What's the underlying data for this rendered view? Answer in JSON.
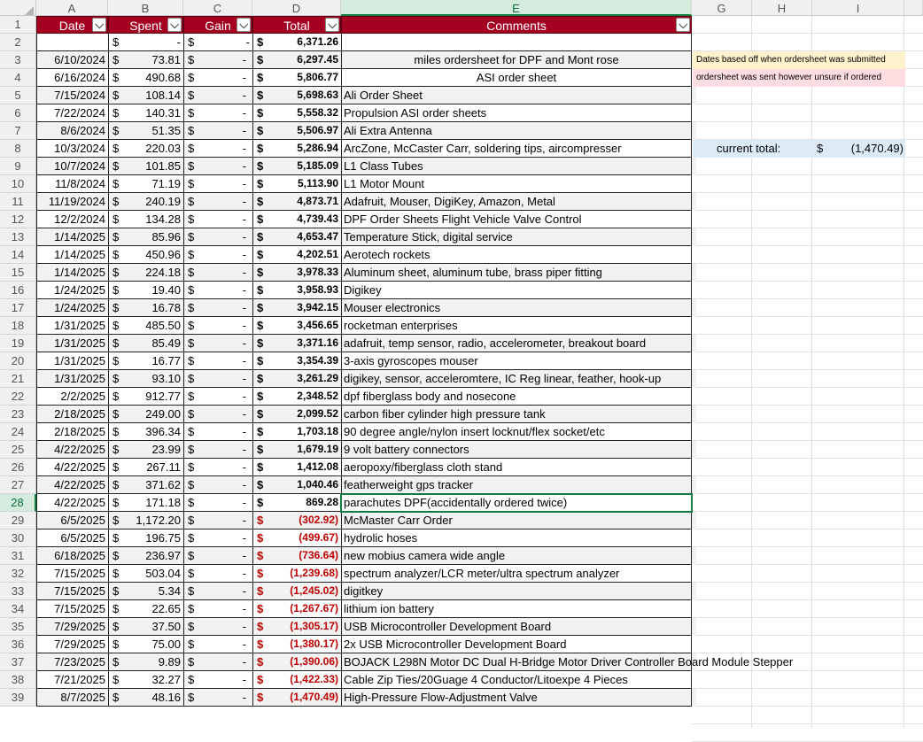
{
  "columns": [
    "A",
    "B",
    "C",
    "D",
    "E",
    "G",
    "H",
    "I"
  ],
  "headers": {
    "date": "Date",
    "spent": "Spent",
    "gain": "Gain",
    "total": "Total",
    "comments": "Comments"
  },
  "currency": "$",
  "first_row": {
    "row": "2",
    "spent": "-",
    "gain": "-",
    "total": "6,371.26",
    "comment": ""
  },
  "rows": [
    {
      "row": "3",
      "date": "6/10/2024",
      "spent": "73.81",
      "gain": "-",
      "total": "6,297.45",
      "comment": "miles ordersheet for DPF and Mont rose",
      "neg": false,
      "center": true
    },
    {
      "row": "4",
      "date": "6/16/2024",
      "spent": "490.68",
      "gain": "-",
      "total": "5,806.77",
      "comment": "ASI order sheet",
      "neg": false,
      "center": true
    },
    {
      "row": "5",
      "date": "7/15/2024",
      "spent": "108.14",
      "gain": "-",
      "total": "5,698.63",
      "comment": "Ali Order Sheet",
      "neg": false
    },
    {
      "row": "6",
      "date": "7/22/2024",
      "spent": "140.31",
      "gain": "-",
      "total": "5,558.32",
      "comment": "Propulsion ASI order sheets",
      "neg": false
    },
    {
      "row": "7",
      "date": "8/6/2024",
      "spent": "51.35",
      "gain": "-",
      "total": "5,506.97",
      "comment": "Ali Extra Antenna",
      "neg": false
    },
    {
      "row": "8",
      "date": "10/3/2024",
      "spent": "220.03",
      "gain": "-",
      "total": "5,286.94",
      "comment": "ArcZone, McCaster Carr, soldering tips, aircompresser",
      "neg": false
    },
    {
      "row": "9",
      "date": "10/7/2024",
      "spent": "101.85",
      "gain": "-",
      "total": "5,185.09",
      "comment": "L1 Class Tubes",
      "neg": false
    },
    {
      "row": "10",
      "date": "11/8/2024",
      "spent": "71.19",
      "gain": "-",
      "total": "5,113.90",
      "comment": "L1 Motor Mount",
      "neg": false
    },
    {
      "row": "11",
      "date": "11/19/2024",
      "spent": "240.19",
      "gain": "-",
      "total": "4,873.71",
      "comment": "Adafruit, Mouser, DigiKey, Amazon, Metal",
      "neg": false
    },
    {
      "row": "12",
      "date": "12/2/2024",
      "spent": "134.28",
      "gain": "-",
      "total": "4,739.43",
      "comment": "DPF Order Sheets Flight Vehicle Valve Control",
      "neg": false
    },
    {
      "row": "13",
      "date": "1/14/2025",
      "spent": "85.96",
      "gain": "-",
      "total": "4,653.47",
      "comment": "Temperature Stick, digital service",
      "neg": false
    },
    {
      "row": "14",
      "date": "1/14/2025",
      "spent": "450.96",
      "gain": "-",
      "total": "4,202.51",
      "comment": "Aerotech rockets",
      "neg": false
    },
    {
      "row": "15",
      "date": "1/14/2025",
      "spent": "224.18",
      "gain": "-",
      "total": "3,978.33",
      "comment": "Aluminum sheet, aluminum tube, brass piper fitting",
      "neg": false
    },
    {
      "row": "16",
      "date": "1/24/2025",
      "spent": "19.40",
      "gain": "-",
      "total": "3,958.93",
      "comment": "Digikey",
      "neg": false
    },
    {
      "row": "17",
      "date": "1/24/2025",
      "spent": "16.78",
      "gain": "-",
      "total": "3,942.15",
      "comment": "Mouser electronics",
      "neg": false
    },
    {
      "row": "18",
      "date": "1/31/2025",
      "spent": "485.50",
      "gain": "-",
      "total": "3,456.65",
      "comment": "rocketman enterprises",
      "neg": false
    },
    {
      "row": "19",
      "date": "1/31/2025",
      "spent": "85.49",
      "gain": "-",
      "total": "3,371.16",
      "comment": "adafruit, temp sensor, radio, accelerometer, breakout board",
      "neg": false
    },
    {
      "row": "20",
      "date": "1/31/2025",
      "spent": "16.77",
      "gain": "-",
      "total": "3,354.39",
      "comment": "3-axis gyroscopes mouser",
      "neg": false
    },
    {
      "row": "21",
      "date": "1/31/2025",
      "spent": "93.10",
      "gain": "-",
      "total": "3,261.29",
      "comment": "digikey, sensor, acceleromtere, IC Reg linear, feather, hook-up",
      "neg": false
    },
    {
      "row": "22",
      "date": "2/2/2025",
      "spent": "912.77",
      "gain": "-",
      "total": "2,348.52",
      "comment": "dpf fiberglass body and nosecone",
      "neg": false
    },
    {
      "row": "23",
      "date": "2/18/2025",
      "spent": "249.00",
      "gain": "-",
      "total": "2,099.52",
      "comment": "carbon fiber cylinder high pressure tank",
      "neg": false
    },
    {
      "row": "24",
      "date": "2/18/2025",
      "spent": "396.34",
      "gain": "-",
      "total": "1,703.18",
      "comment": "90 degree angle/nylon insert locknut/flex socket/etc",
      "neg": false
    },
    {
      "row": "25",
      "date": "4/22/2025",
      "spent": "23.99",
      "gain": "-",
      "total": "1,679.19",
      "comment": "9 volt battery connectors",
      "neg": false
    },
    {
      "row": "26",
      "date": "4/22/2025",
      "spent": "267.11",
      "gain": "-",
      "total": "1,412.08",
      "comment": "aeropoxy/fiberglass cloth stand",
      "neg": false
    },
    {
      "row": "27",
      "date": "4/22/2025",
      "spent": "371.62",
      "gain": "-",
      "total": "1,040.46",
      "comment": "featherweight gps tracker",
      "neg": false
    },
    {
      "row": "28",
      "date": "4/22/2025",
      "spent": "171.18",
      "gain": "-",
      "total": "869.28",
      "comment": "parachutes DPF(accidentally ordered twice)",
      "neg": false
    },
    {
      "row": "29",
      "date": "6/5/2025",
      "spent": "1,172.20",
      "gain": "-",
      "total": "(302.92)",
      "comment": "McMaster Carr Order",
      "neg": true
    },
    {
      "row": "30",
      "date": "6/5/2025",
      "spent": "196.75",
      "gain": "-",
      "total": "(499.67)",
      "comment": "hydrolic hoses",
      "neg": true
    },
    {
      "row": "31",
      "date": "6/18/2025",
      "spent": "236.97",
      "gain": "-",
      "total": "(736.64)",
      "comment": "new mobius camera wide angle",
      "neg": true
    },
    {
      "row": "32",
      "date": "7/15/2025",
      "spent": "503.04",
      "gain": "-",
      "total": "(1,239.68)",
      "comment": "spectrum analyzer/LCR meter/ultra spectrum analyzer",
      "neg": true
    },
    {
      "row": "33",
      "date": "7/15/2025",
      "spent": "5.34",
      "gain": "-",
      "total": "(1,245.02)",
      "comment": "digitkey",
      "neg": true
    },
    {
      "row": "34",
      "date": "7/15/2025",
      "spent": "22.65",
      "gain": "-",
      "total": "(1,267.67)",
      "comment": "lithium ion battery",
      "neg": true
    },
    {
      "row": "35",
      "date": "7/29/2025",
      "spent": "37.50",
      "gain": "-",
      "total": "(1,305.17)",
      "comment": "USB Microcontroller Development Board",
      "neg": true
    },
    {
      "row": "36",
      "date": "7/29/2025",
      "spent": "75.00",
      "gain": "-",
      "total": "(1,380.17)",
      "comment": "2x USB Microcontroller Development Board",
      "neg": true
    },
    {
      "row": "37",
      "date": "7/23/2025",
      "spent": "9.89",
      "gain": "-",
      "total": "(1,390.06)",
      "comment": "BOJACK L298N Motor DC Dual H-Bridge Motor Driver Controller Board Module Stepper",
      "neg": true
    },
    {
      "row": "38",
      "date": "7/21/2025",
      "spent": "32.27",
      "gain": "-",
      "total": "(1,422.33)",
      "comment": "Cable Zip Ties/20Guage 4 Conductor/Litoexpe 4 Pieces",
      "neg": true
    },
    {
      "row": "39",
      "date": "8/7/2025",
      "spent": "48.16",
      "gain": "-",
      "total": "(1,470.49)",
      "comment": "High-Pressure Flow-Adjustment Valve",
      "neg": true
    }
  ],
  "notes": {
    "yellow": "Dates based off when ordersheet was submitted",
    "pink": "ordersheet was sent however unsure if ordered",
    "yellow_color": "#fff2cc",
    "pink_color": "#ffdde0"
  },
  "summary": {
    "label": "current total:",
    "currency": "$",
    "value": "(1,470.49)",
    "color": "#ddebf7"
  },
  "colors": {
    "header_bg": "#a50021",
    "negative": "#c00000",
    "selection": "#107c41"
  },
  "selection": {
    "cell": "E28",
    "column": "E",
    "row": "28"
  }
}
